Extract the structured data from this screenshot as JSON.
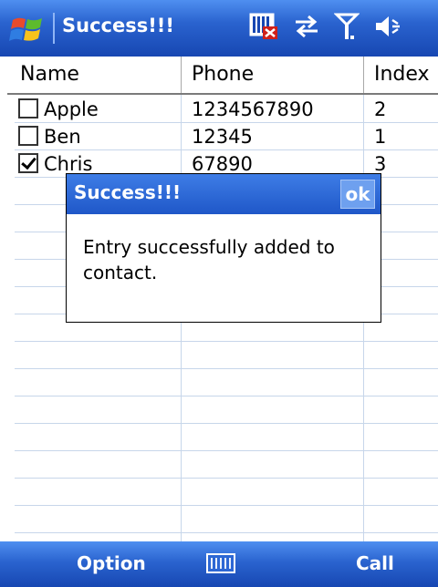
{
  "title_bar": {
    "title": "Success!!!",
    "icons": [
      "windows-start-logo",
      "sim-card-error-icon",
      "connectivity-arrows-icon",
      "signal-antenna-icon",
      "speaker-volume-icon"
    ]
  },
  "table": {
    "columns": [
      "Name",
      "Phone",
      "Index"
    ],
    "rows": [
      {
        "checked": false,
        "name": "Apple",
        "phone": "1234567890",
        "index": "2"
      },
      {
        "checked": false,
        "name": "Ben",
        "phone": "12345",
        "index": "1"
      },
      {
        "checked": true,
        "name": "Chris",
        "phone": "67890",
        "index": "3"
      }
    ]
  },
  "dialog": {
    "title": "Success!!!",
    "ok_label": "ok",
    "message": "Entry successfully added to contact."
  },
  "menu_bar": {
    "left_label": "Option",
    "right_label": "Call",
    "center_icon": "keyboard-icon"
  },
  "colors": {
    "bar_blue": "#2a63cf",
    "grid_line": "#c7d6ea"
  }
}
